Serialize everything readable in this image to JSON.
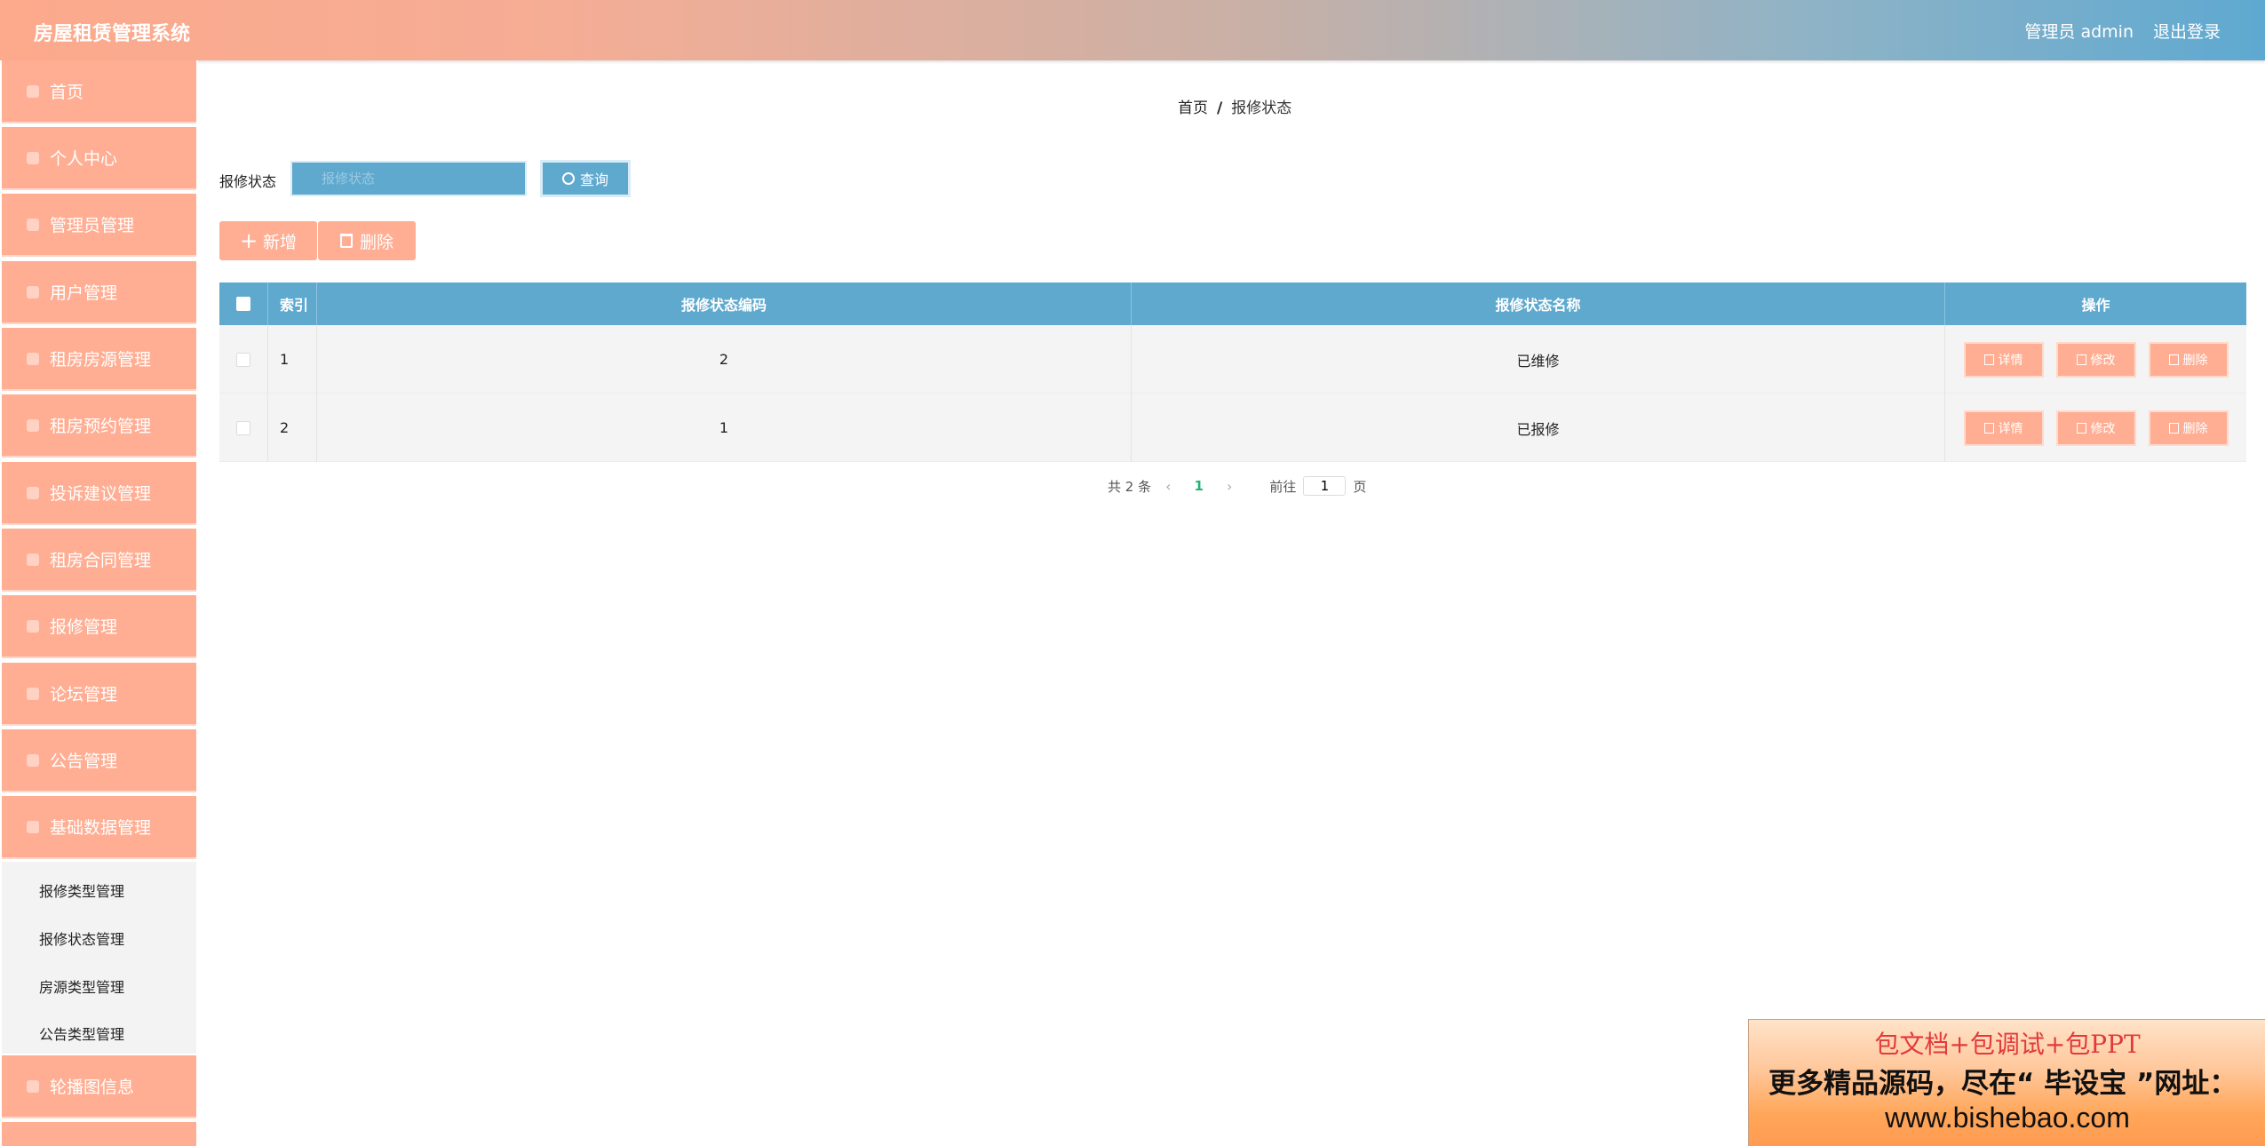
{
  "header": {
    "app_title": "房屋租赁管理系统",
    "user_info": "管理员 admin",
    "logout": "退出登录"
  },
  "sidebar": {
    "items": [
      {
        "label": "首页",
        "icon": "home-icon"
      },
      {
        "label": "个人中心",
        "icon": "user-icon"
      },
      {
        "label": "管理员管理",
        "icon": "admin-icon"
      },
      {
        "label": "用户管理",
        "icon": "users-icon"
      },
      {
        "label": "租房房源管理",
        "icon": "house-icon"
      },
      {
        "label": "租房预约管理",
        "icon": "calendar-icon"
      },
      {
        "label": "投诉建议管理",
        "icon": "chat-icon"
      },
      {
        "label": "租房合同管理",
        "icon": "contract-icon"
      },
      {
        "label": "报修管理",
        "icon": "wrench-icon"
      },
      {
        "label": "论坛管理",
        "icon": "forum-icon"
      },
      {
        "label": "公告管理",
        "icon": "notice-icon"
      },
      {
        "label": "基础数据管理",
        "icon": "database-icon"
      },
      {
        "label": "轮播图信息",
        "icon": "image-icon"
      }
    ],
    "submenu": [
      "报修类型管理",
      "报修状态管理",
      "房源类型管理",
      "公告类型管理"
    ]
  },
  "breadcrumb": {
    "home": "首页",
    "separator": "/",
    "current": "报修状态"
  },
  "search": {
    "label": "报修状态",
    "placeholder": "报修状态",
    "button": "查询"
  },
  "actions": {
    "add": "新增",
    "delete": "删除"
  },
  "table": {
    "headers": [
      "索引",
      "报修状态编码",
      "报修状态名称",
      "操作"
    ],
    "rows": [
      {
        "index": "1",
        "code": "2",
        "name": "已维修"
      },
      {
        "index": "2",
        "code": "1",
        "name": "已报修"
      }
    ],
    "row_actions": {
      "detail": "详情",
      "edit": "修改",
      "delete": "删除"
    }
  },
  "pagination": {
    "total": "共 2 条",
    "current_page": "1",
    "goto_label": "前往",
    "goto_value": "1",
    "page_suffix": "页"
  },
  "promo": {
    "line1": "包文档+包调试+包PPT",
    "line2": "更多精品源码，尽在“ 毕设宝 ”网址：",
    "line3": "www.bishebao.com"
  },
  "colors": {
    "accent_salmon": "#ffae93",
    "accent_blue": "#5fa9cf",
    "page_active": "#22b372"
  }
}
